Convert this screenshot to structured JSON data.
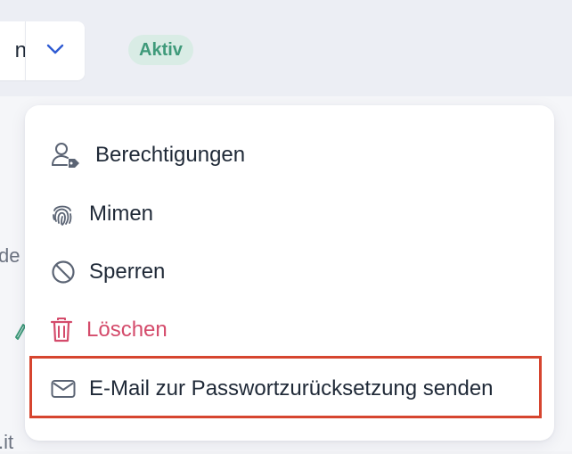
{
  "header": {
    "split_button_text": "n",
    "dropdown_icon": "chevron-down-icon",
    "status_badge": "Aktiv"
  },
  "background": {
    "frag_1": "de",
    "frag_2": ".it"
  },
  "menu": {
    "items": [
      {
        "label": "Berechtigungen",
        "icon": "user-tag-icon",
        "danger": false
      },
      {
        "label": "Mimen",
        "icon": "fingerprint-icon",
        "danger": false
      },
      {
        "label": "Sperren",
        "icon": "ban-icon",
        "danger": false
      },
      {
        "label": "Löschen",
        "icon": "trash-icon",
        "danger": true
      },
      {
        "label": "E-Mail zur Passwortzurücksetzung senden",
        "icon": "envelope-icon",
        "danger": false,
        "highlighted": true
      }
    ]
  },
  "colors": {
    "accent_blue": "#2f5bd3",
    "danger": "#d44b6b",
    "badge_bg": "#d9ece5",
    "badge_text": "#3f9a7a",
    "highlight": "#d6452f",
    "icon_gray": "#5b6474"
  }
}
